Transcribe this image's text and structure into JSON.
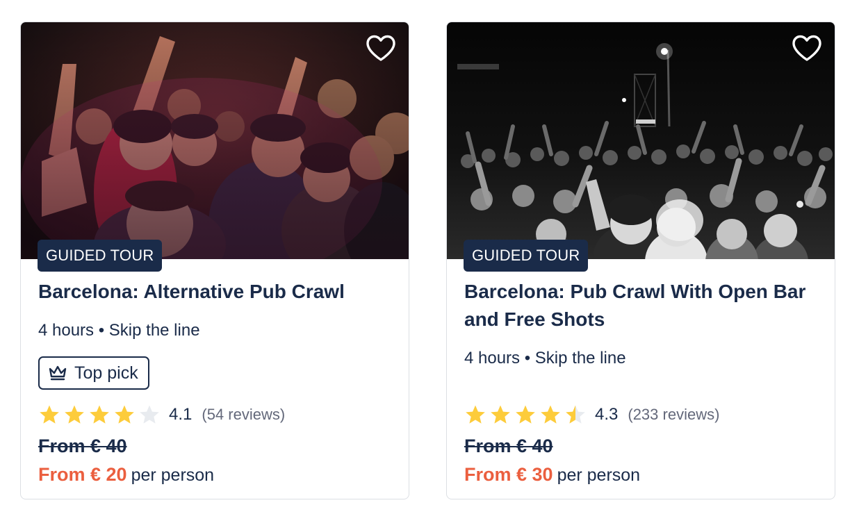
{
  "accent_colors": {
    "navy": "#1a2b49",
    "sale_orange": "#eb5f3f",
    "star_yellow": "#fdcc3b",
    "star_empty": "#e8ebef"
  },
  "cards": [
    {
      "image": "photo-crowd-color",
      "wishlist_icon": "heart-outline-icon",
      "badge": "GUIDED TOUR",
      "title": "Barcelona: Alternative Pub Crawl",
      "meta": "4 hours • Skip the line",
      "top_pick": {
        "icon": "crown-icon",
        "label": "Top pick"
      },
      "rating": {
        "stars": 4.1,
        "score": "4.1",
        "reviews": "(54 reviews)"
      },
      "old_price": "From € 40",
      "price": {
        "amount": "From € 20",
        "unit": "per person"
      }
    },
    {
      "image": "photo-crowd-bw",
      "wishlist_icon": "heart-outline-icon",
      "badge": "GUIDED TOUR",
      "title": "Barcelona: Pub Crawl With Open Bar and Free Shots",
      "meta": "4 hours • Skip the line",
      "rating": {
        "stars": 4.3,
        "score": "4.3",
        "reviews": "(233 reviews)"
      },
      "old_price": "From € 40",
      "price": {
        "amount": "From € 30",
        "unit": "per person"
      }
    }
  ]
}
